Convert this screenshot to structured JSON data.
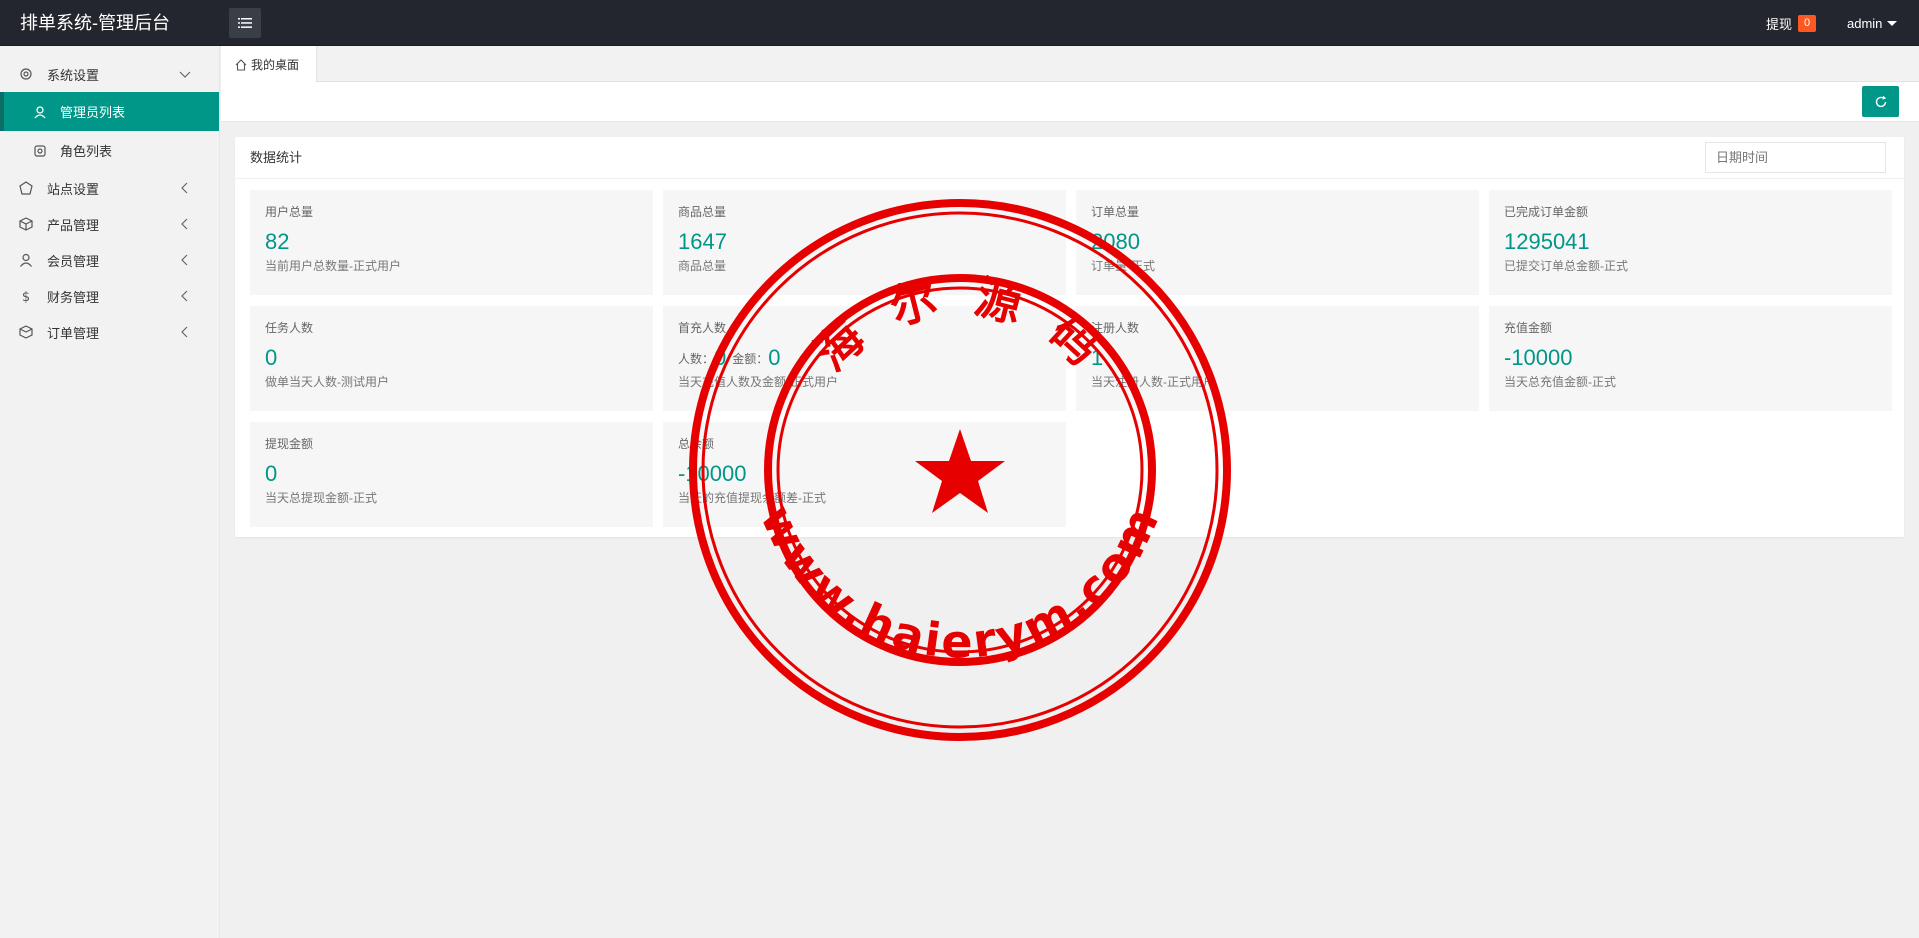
{
  "header": {
    "title": "排单系统-管理后台",
    "withdraw_label": "提现",
    "withdraw_count": "0",
    "user_name": "admin"
  },
  "sidebar": {
    "items": [
      {
        "label": "系统设置",
        "icon": "gear-icon",
        "expanded": true
      },
      {
        "label": "管理员列表",
        "icon": "admin-user-icon",
        "active": true
      },
      {
        "label": "角色列表",
        "icon": "role-icon"
      },
      {
        "label": "站点设置",
        "icon": "site-icon"
      },
      {
        "label": "产品管理",
        "icon": "box-icon"
      },
      {
        "label": "会员管理",
        "icon": "user-icon"
      },
      {
        "label": "财务管理",
        "icon": "dollar-icon"
      },
      {
        "label": "订单管理",
        "icon": "order-icon"
      }
    ]
  },
  "tabs": {
    "home_label": "我的桌面"
  },
  "main": {
    "card_title": "数据统计",
    "date_placeholder": "日期时间",
    "stats": [
      {
        "label": "用户总量",
        "value": "82",
        "sub": "当前用户总数量-正式用户"
      },
      {
        "label": "商品总量",
        "value": "1647",
        "sub": "商品总量"
      },
      {
        "label": "订单总量",
        "value": "2080",
        "sub": "订单量-正式"
      },
      {
        "label": "已完成订单金额",
        "value": "1295041",
        "sub": "已提交订单总金额-正式"
      },
      {
        "label": "任务人数",
        "value": "0",
        "sub": "做单当天人数-测试用户"
      },
      {
        "label": "首充人数",
        "people_label": "人数：",
        "people_value": "0",
        "amount_label": "金额：",
        "amount_value": "0",
        "sub": "当天充值人数及金额-正式用户"
      },
      {
        "label": "注册人数",
        "value": "1",
        "sub": "当天注册人数-正式用户"
      },
      {
        "label": "充值金额",
        "value": "-10000",
        "sub": "当天总充值金额-正式"
      },
      {
        "label": "提现金额",
        "value": "0",
        "sub": "当天总提现金额-正式"
      },
      {
        "label": "总余额",
        "value": "-10000",
        "sub": "当天的充值提现余额差-正式"
      }
    ]
  },
  "watermark": {
    "top_text": "海 尔 源 码",
    "bottom_text": "www.haierym.com",
    "color": "#e60000"
  },
  "colors": {
    "accent": "#009688",
    "header_bg": "#23262e",
    "badge": "#ff5722"
  }
}
